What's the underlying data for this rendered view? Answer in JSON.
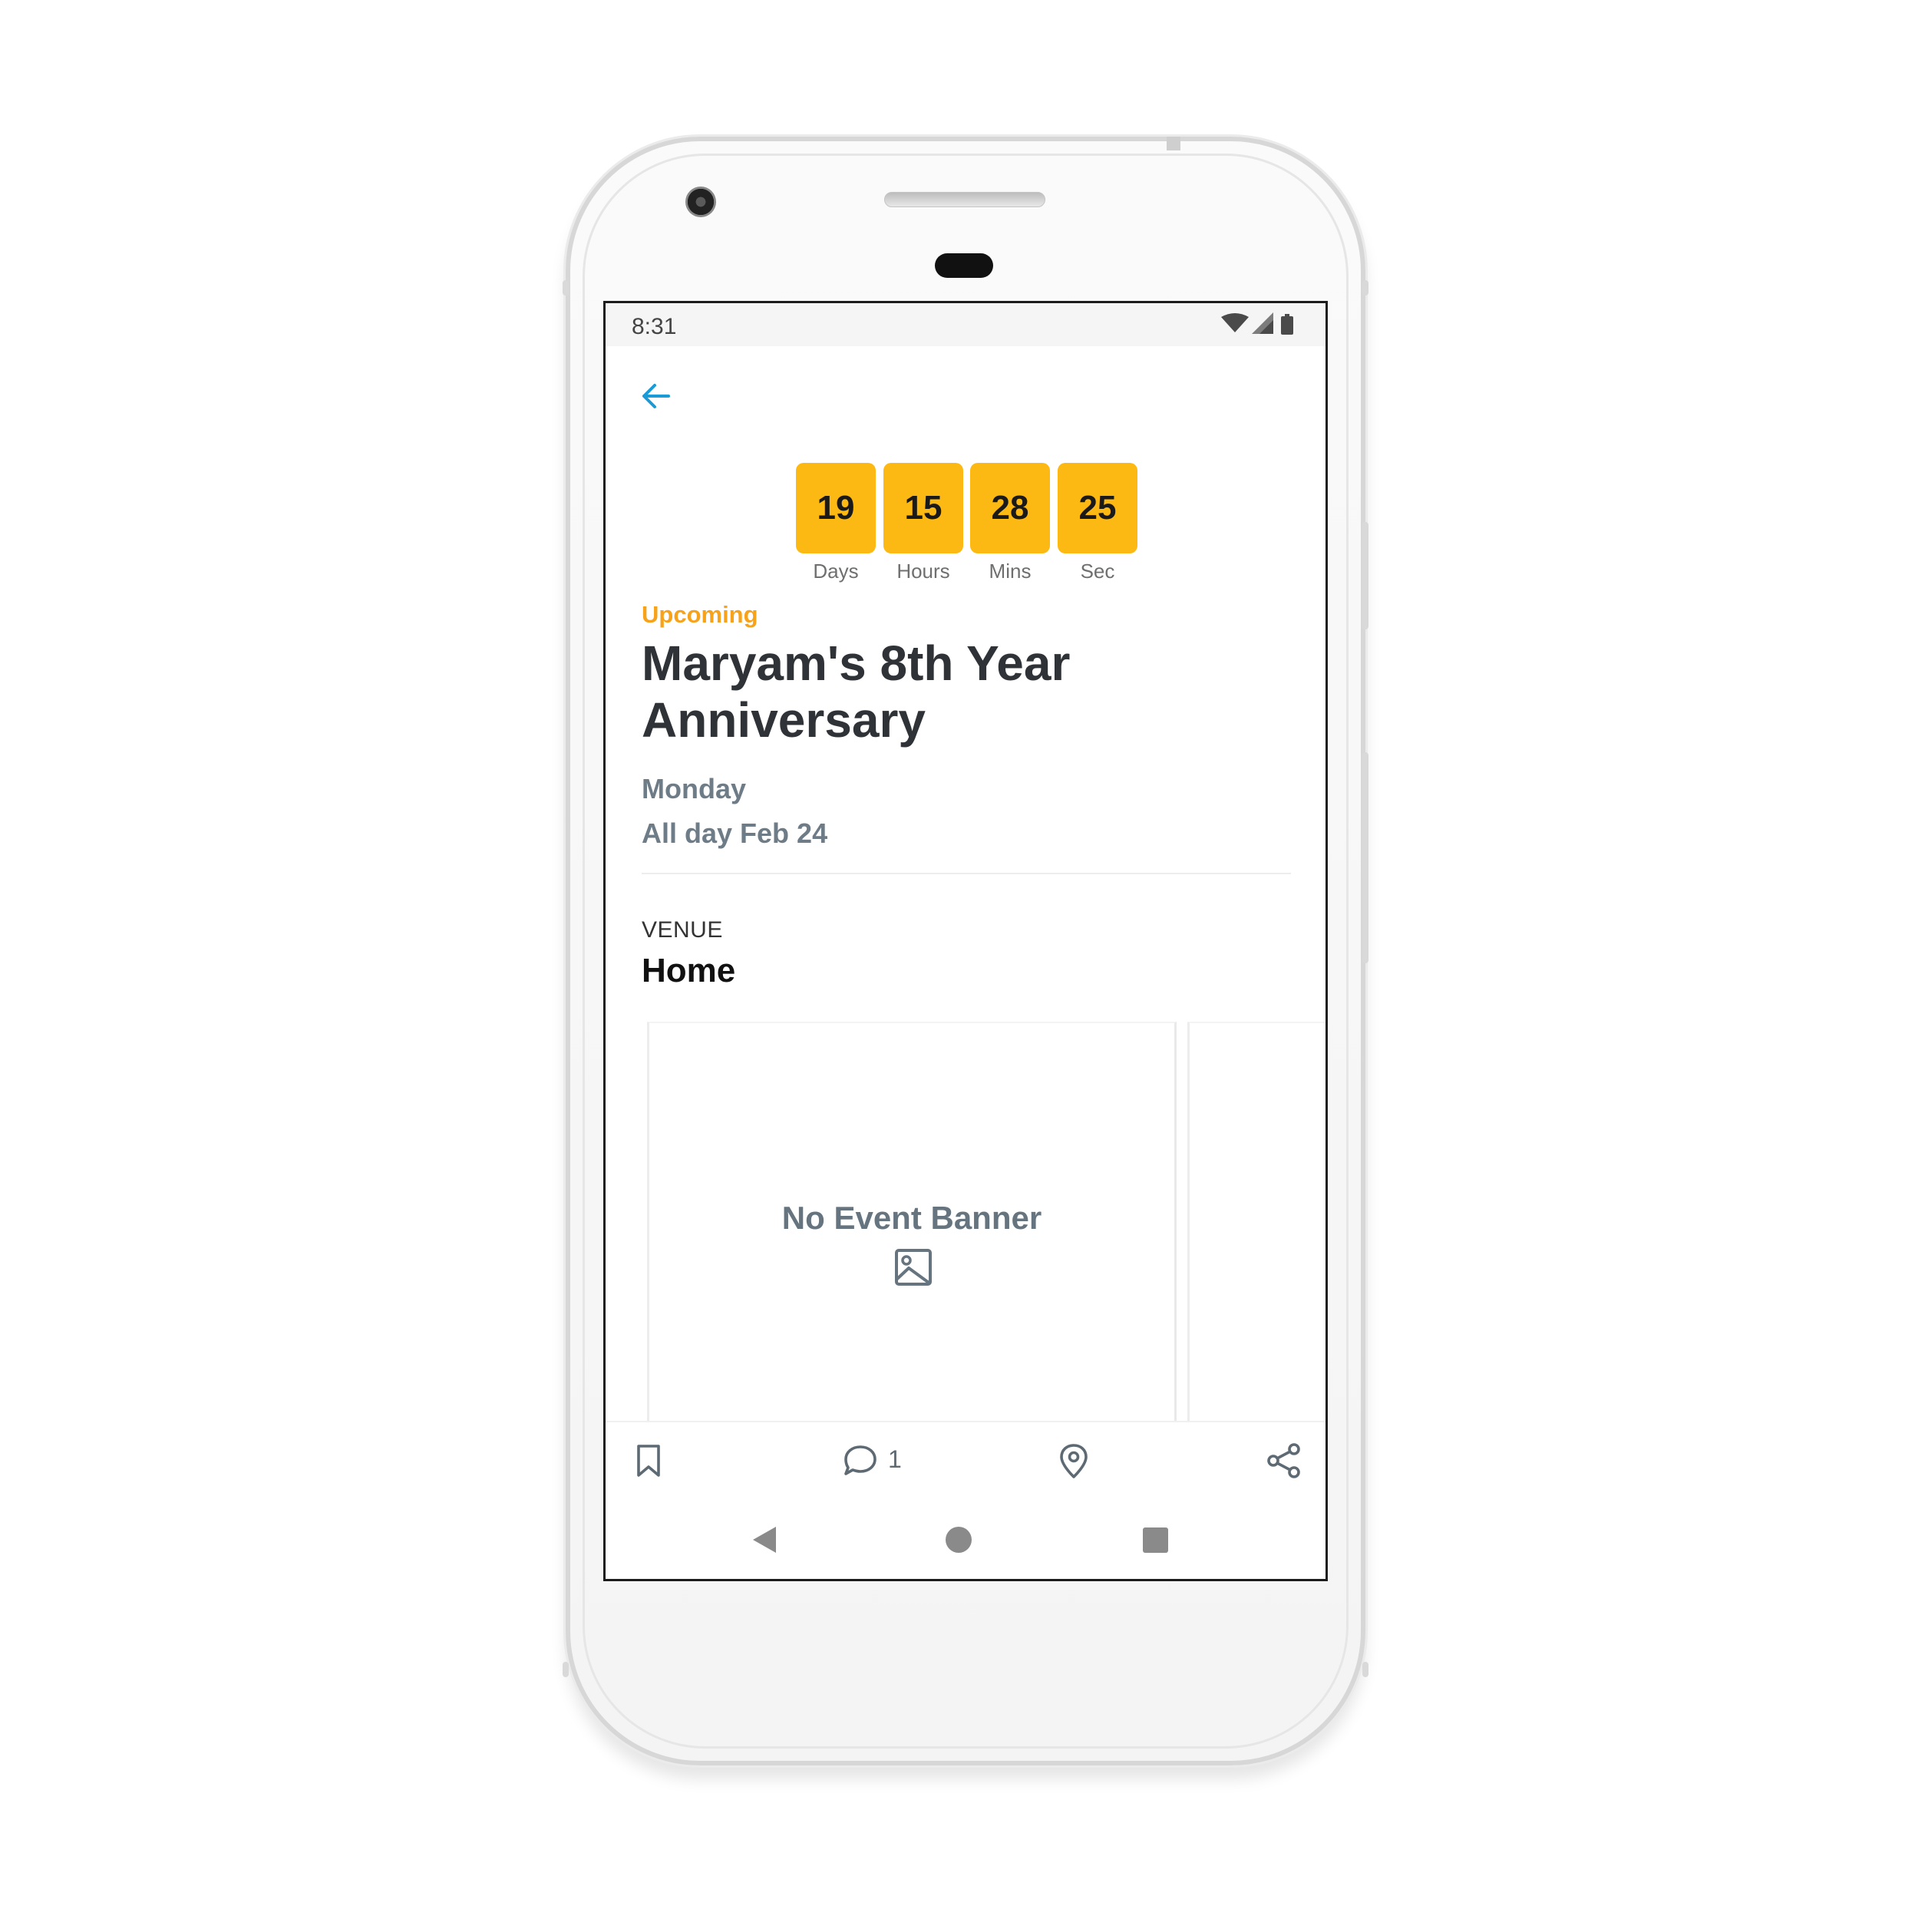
{
  "status_bar": {
    "time": "8:31"
  },
  "icons": {
    "back": "arrow-left-icon",
    "bookmark": "bookmark-icon",
    "comment": "comment-icon",
    "location": "location-pin-icon",
    "share": "share-icon",
    "banner_placeholder": "image-icon"
  },
  "colors": {
    "accent": "#1a9bd7",
    "countdown_bg": "#fdb913",
    "status_orange": "#f7a21b",
    "muted": "#6e7c87"
  },
  "countdown": [
    {
      "value": "19",
      "label": "Days"
    },
    {
      "value": "15",
      "label": "Hours"
    },
    {
      "value": "28",
      "label": "Mins"
    },
    {
      "value": "25",
      "label": "Sec"
    }
  ],
  "event": {
    "status": "Upcoming",
    "title": "Maryam's 8th Year Anniversary",
    "day": "Monday",
    "date": "All day Feb 24"
  },
  "venue": {
    "label": "VENUE",
    "name": "Home"
  },
  "banner": {
    "placeholder_text": "No Event Banner"
  },
  "actions": {
    "comment_count": "1"
  }
}
